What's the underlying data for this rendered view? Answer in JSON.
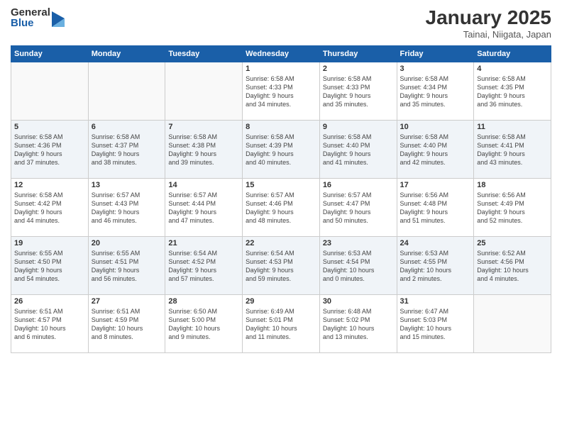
{
  "logo": {
    "general": "General",
    "blue": "Blue"
  },
  "header": {
    "month": "January 2025",
    "location": "Tainai, Niigata, Japan"
  },
  "weekdays": [
    "Sunday",
    "Monday",
    "Tuesday",
    "Wednesday",
    "Thursday",
    "Friday",
    "Saturday"
  ],
  "weeks": [
    [
      {
        "day": "",
        "info": ""
      },
      {
        "day": "",
        "info": ""
      },
      {
        "day": "",
        "info": ""
      },
      {
        "day": "1",
        "info": "Sunrise: 6:58 AM\nSunset: 4:33 PM\nDaylight: 9 hours\nand 34 minutes."
      },
      {
        "day": "2",
        "info": "Sunrise: 6:58 AM\nSunset: 4:33 PM\nDaylight: 9 hours\nand 35 minutes."
      },
      {
        "day": "3",
        "info": "Sunrise: 6:58 AM\nSunset: 4:34 PM\nDaylight: 9 hours\nand 35 minutes."
      },
      {
        "day": "4",
        "info": "Sunrise: 6:58 AM\nSunset: 4:35 PM\nDaylight: 9 hours\nand 36 minutes."
      }
    ],
    [
      {
        "day": "5",
        "info": "Sunrise: 6:58 AM\nSunset: 4:36 PM\nDaylight: 9 hours\nand 37 minutes."
      },
      {
        "day": "6",
        "info": "Sunrise: 6:58 AM\nSunset: 4:37 PM\nDaylight: 9 hours\nand 38 minutes."
      },
      {
        "day": "7",
        "info": "Sunrise: 6:58 AM\nSunset: 4:38 PM\nDaylight: 9 hours\nand 39 minutes."
      },
      {
        "day": "8",
        "info": "Sunrise: 6:58 AM\nSunset: 4:39 PM\nDaylight: 9 hours\nand 40 minutes."
      },
      {
        "day": "9",
        "info": "Sunrise: 6:58 AM\nSunset: 4:40 PM\nDaylight: 9 hours\nand 41 minutes."
      },
      {
        "day": "10",
        "info": "Sunrise: 6:58 AM\nSunset: 4:40 PM\nDaylight: 9 hours\nand 42 minutes."
      },
      {
        "day": "11",
        "info": "Sunrise: 6:58 AM\nSunset: 4:41 PM\nDaylight: 9 hours\nand 43 minutes."
      }
    ],
    [
      {
        "day": "12",
        "info": "Sunrise: 6:58 AM\nSunset: 4:42 PM\nDaylight: 9 hours\nand 44 minutes."
      },
      {
        "day": "13",
        "info": "Sunrise: 6:57 AM\nSunset: 4:43 PM\nDaylight: 9 hours\nand 46 minutes."
      },
      {
        "day": "14",
        "info": "Sunrise: 6:57 AM\nSunset: 4:44 PM\nDaylight: 9 hours\nand 47 minutes."
      },
      {
        "day": "15",
        "info": "Sunrise: 6:57 AM\nSunset: 4:46 PM\nDaylight: 9 hours\nand 48 minutes."
      },
      {
        "day": "16",
        "info": "Sunrise: 6:57 AM\nSunset: 4:47 PM\nDaylight: 9 hours\nand 50 minutes."
      },
      {
        "day": "17",
        "info": "Sunrise: 6:56 AM\nSunset: 4:48 PM\nDaylight: 9 hours\nand 51 minutes."
      },
      {
        "day": "18",
        "info": "Sunrise: 6:56 AM\nSunset: 4:49 PM\nDaylight: 9 hours\nand 52 minutes."
      }
    ],
    [
      {
        "day": "19",
        "info": "Sunrise: 6:55 AM\nSunset: 4:50 PM\nDaylight: 9 hours\nand 54 minutes."
      },
      {
        "day": "20",
        "info": "Sunrise: 6:55 AM\nSunset: 4:51 PM\nDaylight: 9 hours\nand 56 minutes."
      },
      {
        "day": "21",
        "info": "Sunrise: 6:54 AM\nSunset: 4:52 PM\nDaylight: 9 hours\nand 57 minutes."
      },
      {
        "day": "22",
        "info": "Sunrise: 6:54 AM\nSunset: 4:53 PM\nDaylight: 9 hours\nand 59 minutes."
      },
      {
        "day": "23",
        "info": "Sunrise: 6:53 AM\nSunset: 4:54 PM\nDaylight: 10 hours\nand 0 minutes."
      },
      {
        "day": "24",
        "info": "Sunrise: 6:53 AM\nSunset: 4:55 PM\nDaylight: 10 hours\nand 2 minutes."
      },
      {
        "day": "25",
        "info": "Sunrise: 6:52 AM\nSunset: 4:56 PM\nDaylight: 10 hours\nand 4 minutes."
      }
    ],
    [
      {
        "day": "26",
        "info": "Sunrise: 6:51 AM\nSunset: 4:57 PM\nDaylight: 10 hours\nand 6 minutes."
      },
      {
        "day": "27",
        "info": "Sunrise: 6:51 AM\nSunset: 4:59 PM\nDaylight: 10 hours\nand 8 minutes."
      },
      {
        "day": "28",
        "info": "Sunrise: 6:50 AM\nSunset: 5:00 PM\nDaylight: 10 hours\nand 9 minutes."
      },
      {
        "day": "29",
        "info": "Sunrise: 6:49 AM\nSunset: 5:01 PM\nDaylight: 10 hours\nand 11 minutes."
      },
      {
        "day": "30",
        "info": "Sunrise: 6:48 AM\nSunset: 5:02 PM\nDaylight: 10 hours\nand 13 minutes."
      },
      {
        "day": "31",
        "info": "Sunrise: 6:47 AM\nSunset: 5:03 PM\nDaylight: 10 hours\nand 15 minutes."
      },
      {
        "day": "",
        "info": ""
      }
    ]
  ]
}
